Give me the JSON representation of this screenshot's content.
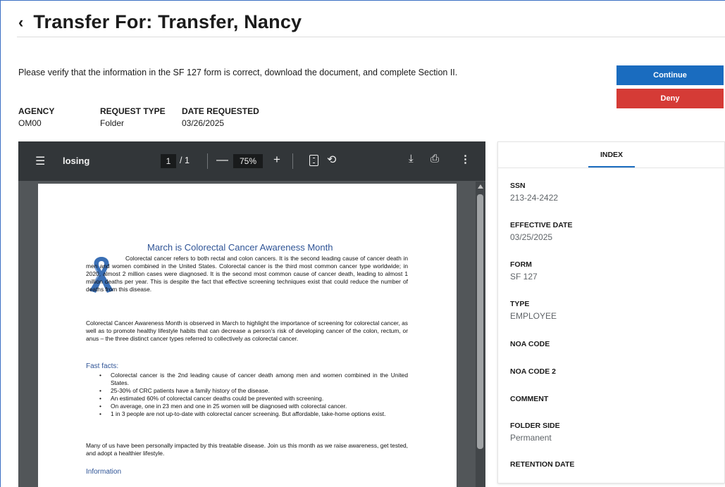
{
  "page": {
    "back_glyph": "‹",
    "title": "Transfer For: Transfer, Nancy",
    "instructions": "Please verify that the information in the SF 127 form is correct, download the document, and complete Section II."
  },
  "actions": {
    "continue_label": "Continue",
    "deny_label": "Deny",
    "continue_color": "#1a6cbf",
    "deny_color": "#d53b36"
  },
  "request": {
    "agency_label": "AGENCY",
    "agency_value": "OM00",
    "type_label": "REQUEST TYPE",
    "type_value": "Folder",
    "date_label": "DATE REQUESTED",
    "date_value": "03/26/2025"
  },
  "viewer": {
    "menu_icon": "menu-icon",
    "doc_name": "losing",
    "current_page": "1",
    "total_pages": "/ 1",
    "zoom": "75%",
    "minus": "—",
    "plus": "+",
    "rotate_glyph": "⟲",
    "download_glyph": "⤓",
    "print_glyph": "⎙",
    "more_glyph": "⋮"
  },
  "document": {
    "title": "March is Colorectal Cancer Awareness Month",
    "para1": "Colorectal cancer refers to both rectal and colon cancers. It is the second leading cause of cancer death in men and women combined in the United States.  Colorectal cancer is the third most common cancer type worldwide; in 2020, almost 2 million cases were diagnosed. It is the second most common cause of cancer death, leading to almost 1 million deaths per year. This is despite the fact that effective screening techniques exist that could reduce the number of deaths from this disease.",
    "para2": "Colorectal Cancer Awareness Month is observed in March to highlight the importance of screening for colorectal cancer, as well as to promote healthy lifestyle habits that can decrease a person’s risk of developing cancer of the colon, rectum, or anus – the three distinct cancer types referred to collectively as colorectal cancer.",
    "facts_heading": "Fast facts:",
    "facts": [
      "Colorectal cancer is the 2nd leading cause of cancer death among men and women combined in the United States.",
      "25-30% of CRC patients have a family history of the disease.",
      "An estimated 60% of colorectal cancer deaths could be prevented with screening.",
      "On average, one in 23 men and one in 25 women will be diagnosed with colorectal cancer.",
      "1 in 3 people are not up-to-date with colorectal cancer screening. But affordable, take-home options exist."
    ],
    "para3": "Many of us have been personally impacted by this treatable disease.  Join us this month as we raise awareness, get tested, and adopt a healthier lifestyle.",
    "info_heading": "Information"
  },
  "index": {
    "tab_label": "INDEX",
    "fields": [
      {
        "label": "SSN",
        "value": "213-24-2422"
      },
      {
        "label": "EFFECTIVE DATE",
        "value": "03/25/2025"
      },
      {
        "label": "FORM",
        "value": "SF 127"
      },
      {
        "label": "TYPE",
        "value": "EMPLOYEE"
      },
      {
        "label": "NOA CODE",
        "value": ""
      },
      {
        "label": "NOA CODE 2",
        "value": ""
      },
      {
        "label": "COMMENT",
        "value": ""
      },
      {
        "label": "FOLDER SIDE",
        "value": "Permanent"
      },
      {
        "label": "RETENTION DATE",
        "value": ""
      }
    ]
  }
}
